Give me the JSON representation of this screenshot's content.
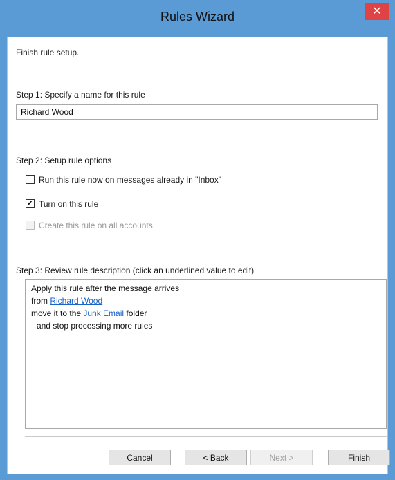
{
  "window": {
    "title": "Rules Wizard",
    "close_label": "✕"
  },
  "intro": "Finish rule setup.",
  "step1": {
    "label": "Step 1: Specify a name for this rule",
    "name_value": "Richard Wood"
  },
  "step2": {
    "label": "Step 2: Setup rule options",
    "options": [
      {
        "label": "Run this rule now on messages already in \"Inbox\"",
        "checked": false,
        "enabled": true
      },
      {
        "label": "Turn on this rule",
        "checked": true,
        "enabled": true
      },
      {
        "label": "Create this rule on all accounts",
        "checked": false,
        "enabled": false
      }
    ]
  },
  "step3": {
    "label": "Step 3: Review rule description (click an underlined value to edit)",
    "line1": "Apply this rule after the message arrives",
    "line2_prefix": "from ",
    "line2_link": "Richard Wood",
    "line3_prefix": "move it to the ",
    "line3_link": "Junk Email",
    "line3_suffix": " folder",
    "line4": "  and stop processing more rules"
  },
  "buttons": {
    "cancel": "Cancel",
    "back": "< Back",
    "next": "Next >",
    "finish": "Finish"
  }
}
